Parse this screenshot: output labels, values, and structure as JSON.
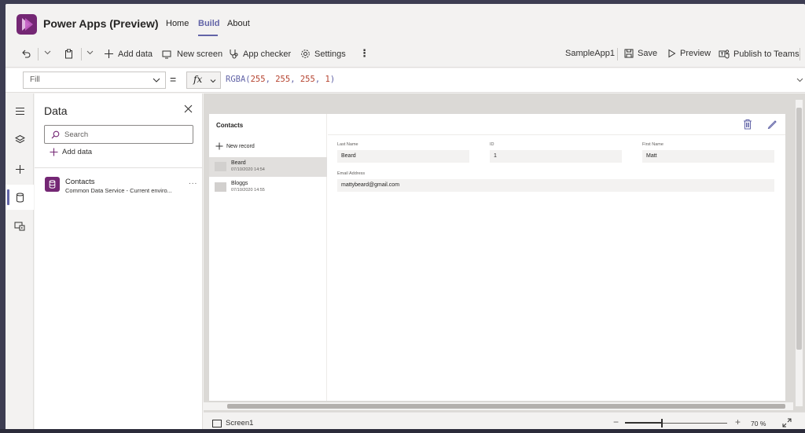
{
  "header": {
    "app_title": "Power Apps (Preview)",
    "nav": [
      "Home",
      "Build",
      "About"
    ],
    "active_nav": "Build"
  },
  "command_bar": {
    "add_data": "Add data",
    "new_screen": "New screen",
    "app_checker": "App checker",
    "settings": "Settings",
    "app_name": "SampleApp1",
    "save": "Save",
    "preview": "Preview",
    "publish": "Publish to Teams"
  },
  "formula_bar": {
    "property": "Fill",
    "equals": "=",
    "fx": "fx",
    "formula_fn": "RGBA(",
    "formula_args": [
      "255",
      "255",
      "255",
      "1"
    ],
    "formula_close": ")"
  },
  "data_panel": {
    "title": "Data",
    "search_placeholder": "Search",
    "add_data": "Add data",
    "sources": [
      {
        "name": "Contacts",
        "subtitle": "Common Data Service - Current enviro...",
        "more": "..."
      }
    ]
  },
  "canvas": {
    "list_title": "Contacts",
    "new_record": "New record",
    "records": [
      {
        "name": "Beard",
        "date": "07/10/2020 14:54",
        "selected": true
      },
      {
        "name": "Bloggs",
        "date": "07/10/2020 14:55",
        "selected": false
      }
    ],
    "fields": {
      "last_name_label": "Last Name",
      "last_name_value": "Beard",
      "id_label": "ID",
      "id_value": "1",
      "first_name_label": "First Name",
      "first_name_value": "Matt",
      "email_label": "Email Address",
      "email_value": "mattybeard@gmail.com"
    }
  },
  "status_bar": {
    "screen_name": "Screen1",
    "zoom_minus": "−",
    "zoom_plus": "+",
    "zoom_value": "70",
    "zoom_unit": "%",
    "zoom_fraction": 0.35
  },
  "colors": {
    "accent": "#6264a7",
    "brand": "#742774"
  }
}
